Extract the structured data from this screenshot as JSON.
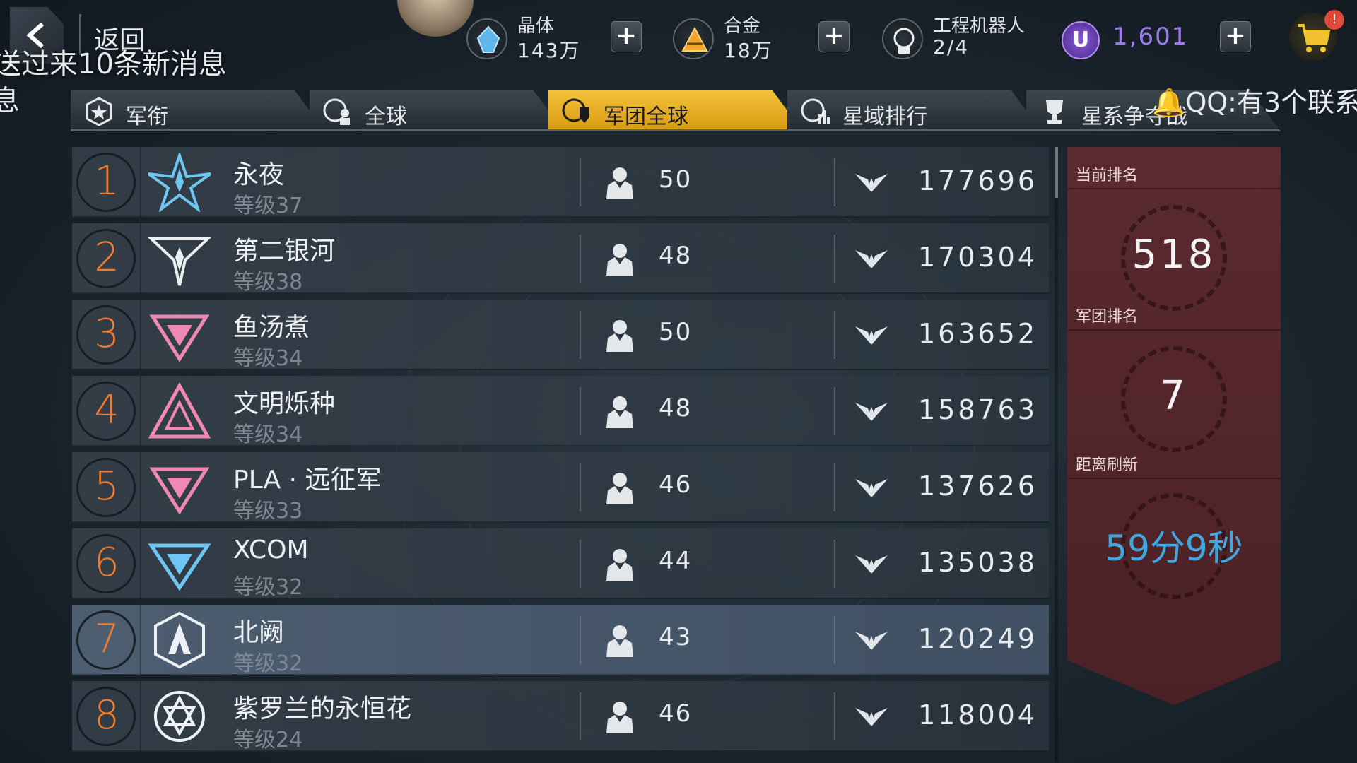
{
  "header": {
    "back_label": "返回",
    "overlay_message": "送过来10条新消息",
    "overlay_message_fragment": "息",
    "resources": [
      {
        "name": "晶体",
        "value": "143万"
      },
      {
        "name": "合金",
        "value": "18万"
      },
      {
        "name": "工程机器人",
        "value": "2/4"
      }
    ],
    "premium_currency": {
      "symbol": "U",
      "value": "1,601"
    },
    "cart_badge": "!"
  },
  "tabs": [
    {
      "label": "军衔",
      "active": false
    },
    {
      "label": "全球",
      "active": false
    },
    {
      "label": "军团全球",
      "active": true
    },
    {
      "label": "星域排行",
      "active": false
    },
    {
      "label": "星系争夺战",
      "active": false
    }
  ],
  "notification": "QQ:有3个联系",
  "rankings": [
    {
      "rank": "1",
      "name": "永夜",
      "level": "等级37",
      "members": "50",
      "power": "177696",
      "emblem": "star-wing-emblem"
    },
    {
      "rank": "2",
      "name": "第二银河",
      "level": "等级38",
      "members": "48",
      "power": "170304",
      "emblem": "arrow-wing-emblem"
    },
    {
      "rank": "3",
      "name": "鱼汤煮",
      "level": "等级34",
      "members": "50",
      "power": "163652",
      "emblem": "pink-chevron-emblem"
    },
    {
      "rank": "4",
      "name": "文明烁种",
      "level": "等级34",
      "members": "48",
      "power": "158763",
      "emblem": "pink-triangle-emblem"
    },
    {
      "rank": "5",
      "name": "PLA · 远征军",
      "level": "等级33",
      "members": "46",
      "power": "137626",
      "emblem": "pink-chevron-emblem"
    },
    {
      "rank": "6",
      "name": "XCOM",
      "level": "等级32",
      "members": "44",
      "power": "135038",
      "emblem": "cyan-chevron-emblem"
    },
    {
      "rank": "7",
      "name": "北阙",
      "level": "等级32",
      "members": "43",
      "power": "120249",
      "emblem": "hexagon-emblem"
    },
    {
      "rank": "8",
      "name": "紫罗兰的永恒花",
      "level": "等级24",
      "members": "46",
      "power": "118004",
      "emblem": "circle-star-emblem"
    }
  ],
  "highlight_rank": "7",
  "side_panel": {
    "current_rank_label": "当前排名",
    "current_rank": "518",
    "legion_rank_label": "军团排名",
    "legion_rank": "7",
    "refresh_label": "距离刷新",
    "refresh_time": "59分9秒"
  },
  "colors": {
    "rank_number": "#f07a2e",
    "active_tab": "#f3c13a",
    "timer": "#3ea8e0",
    "panel": "#5a2a2f",
    "premium": "#9d7ae8"
  }
}
